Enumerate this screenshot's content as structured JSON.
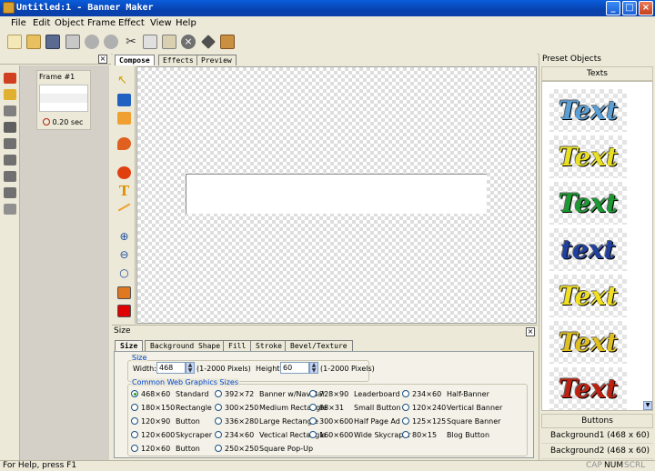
{
  "window": {
    "title": "Untitled:1 - Banner Maker"
  },
  "menu": [
    "File",
    "Edit",
    "Object",
    "Frame",
    "Effect",
    "View",
    "Help"
  ],
  "toolbar_icons": [
    "new-icon",
    "open-icon",
    "save-icon",
    "print-icon",
    "undo-icon",
    "redo-icon",
    "cut-icon",
    "copy-icon",
    "paste-icon",
    "delete-icon",
    "cube-icon",
    "group-icon"
  ],
  "frames": {
    "label": "Frame #1",
    "duration": "0.20 sec"
  },
  "tabs": [
    "Compose",
    "Effects",
    "Preview"
  ],
  "size_panel": {
    "title": "Size",
    "tabs": [
      "Size",
      "Background Shape",
      "Fill",
      "Stroke",
      "Bevel/Texture"
    ],
    "size_group": "Size",
    "width_label": "Width:",
    "width_value": "468",
    "width_range": "(1-2000 Pixels)",
    "height_label": "Height:",
    "height_value": "60",
    "height_range": "(1-2000 Pixels)",
    "common_group": "Common Web Graphics Sizes",
    "options": [
      {
        "size": "468×60",
        "name": "Standard",
        "selected": true
      },
      {
        "size": "392×72",
        "name": "Banner w/Nav Bar"
      },
      {
        "size": "728×90",
        "name": "Leaderboard"
      },
      {
        "size": "234×60",
        "name": "Half-Banner"
      },
      {
        "size": "180×150",
        "name": "Rectangle"
      },
      {
        "size": "300×250",
        "name": "Medium Rectangle"
      },
      {
        "size": "88×31",
        "name": "Small Button"
      },
      {
        "size": "120×240",
        "name": "Vertical Banner"
      },
      {
        "size": "120×90",
        "name": "Button"
      },
      {
        "size": "336×280",
        "name": "Large Rectangle"
      },
      {
        "size": "300×600",
        "name": "Half Page Ad"
      },
      {
        "size": "125×125",
        "name": "Square Banner"
      },
      {
        "size": "120×600",
        "name": "Skycraper"
      },
      {
        "size": "234×60",
        "name": "Vectical Rectangle"
      },
      {
        "size": "160×600",
        "name": "Wide Skycraper"
      },
      {
        "size": "80×15",
        "name": "Blog Button"
      },
      {
        "size": "120×60",
        "name": "Button"
      },
      {
        "size": "250×250",
        "name": "Square Pop-Up"
      }
    ]
  },
  "preset": {
    "title": "Preset Objects",
    "texts_label": "Texts",
    "thumbs": [
      {
        "text": "Text",
        "color": "#5aa0d8"
      },
      {
        "text": "Text",
        "color": "#e8e020"
      },
      {
        "text": "Text",
        "color": "#1a9a30"
      },
      {
        "text": "text",
        "color": "#2040a0"
      },
      {
        "text": "Text",
        "color": "#f0e020"
      },
      {
        "text": "Text",
        "color": "#e0c020"
      },
      {
        "text": "Text",
        "color": "#c02010"
      }
    ],
    "buttons_label": "Buttons",
    "backgrounds": [
      "Background1 (468 x 60)",
      "Background2 (468 x 60)"
    ]
  },
  "status": {
    "help": "For Help, press F1",
    "indicators": [
      "CAP",
      "NUM",
      "SCRL"
    ]
  }
}
